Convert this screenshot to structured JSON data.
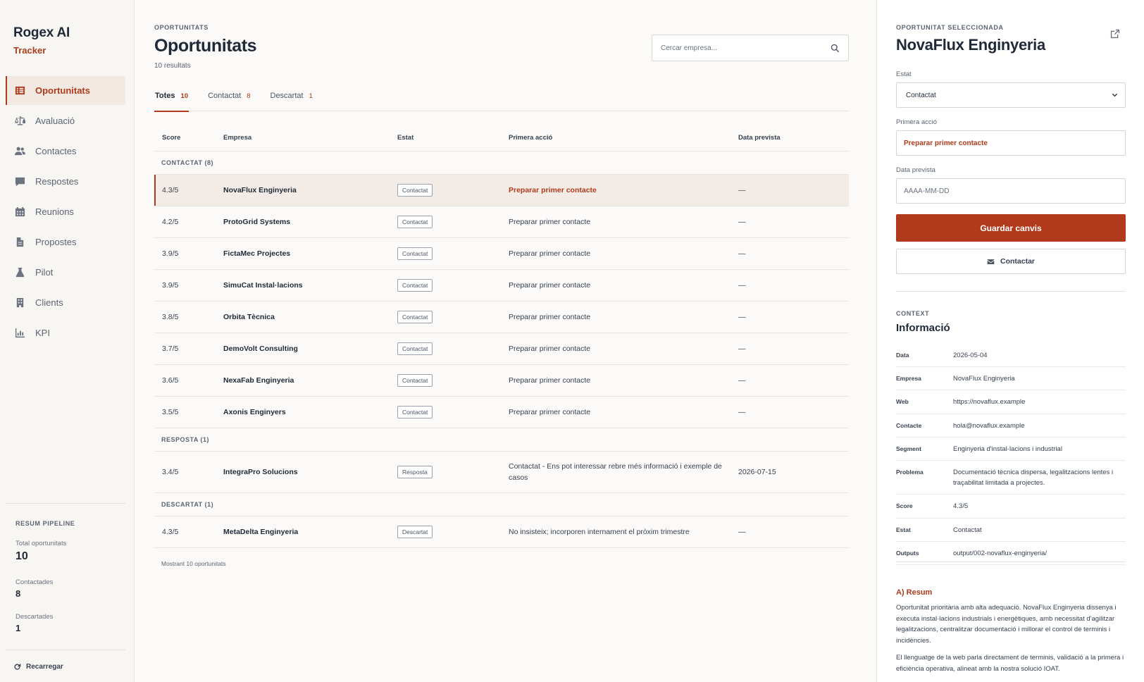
{
  "brand": {
    "title": "Rogex AI",
    "subtitle": "Tracker"
  },
  "sidebar": {
    "items": [
      {
        "label": "Oportunitats",
        "icon": "list-icon"
      },
      {
        "label": "Avaluació",
        "icon": "scale-icon"
      },
      {
        "label": "Contactes",
        "icon": "users-icon"
      },
      {
        "label": "Respostes",
        "icon": "comment-icon"
      },
      {
        "label": "Reunions",
        "icon": "calendar-icon"
      },
      {
        "label": "Propostes",
        "icon": "file-icon"
      },
      {
        "label": "Pilot",
        "icon": "flask-icon"
      },
      {
        "label": "Clients",
        "icon": "building-icon"
      },
      {
        "label": "KPI",
        "icon": "bar-chart-icon"
      }
    ],
    "pipeline": {
      "title": "Resum pipeline",
      "total_label": "Total oportunitats",
      "total_value": "10",
      "contacted_label": "Contactades",
      "contacted_value": "8",
      "discarded_label": "Descartades",
      "discarded_value": "1"
    },
    "reload_label": "Recarregar"
  },
  "main": {
    "eyebrow": "Oportunitats",
    "title": "Oportunitats",
    "count": "10 resultats",
    "search_placeholder": "Cercar empresa...",
    "tabs": [
      {
        "label": "Totes",
        "count": "10"
      },
      {
        "label": "Contactat",
        "count": "8"
      },
      {
        "label": "Descartat",
        "count": "1"
      }
    ],
    "columns": {
      "score": "Score",
      "empresa": "Empresa",
      "estat": "Estat",
      "accio": "Primera acció",
      "data": "Data prevista"
    },
    "groups": [
      {
        "label": "Contactat (8)",
        "rows": [
          {
            "score": "4.3/5",
            "empresa": "NovaFlux Enginyeria",
            "estat": "Contactat",
            "accio": "Preparar primer contacte",
            "data": "—"
          },
          {
            "score": "4.2/5",
            "empresa": "ProtoGrid Systems",
            "estat": "Contactat",
            "accio": "Preparar primer contacte",
            "data": "—"
          },
          {
            "score": "3.9/5",
            "empresa": "FictaMec Projectes",
            "estat": "Contactat",
            "accio": "Preparar primer contacte",
            "data": "—"
          },
          {
            "score": "3.9/5",
            "empresa": "SimuCat Instal·lacions",
            "estat": "Contactat",
            "accio": "Preparar primer contacte",
            "data": "—"
          },
          {
            "score": "3.8/5",
            "empresa": "Orbita Tècnica",
            "estat": "Contactat",
            "accio": "Preparar primer contacte",
            "data": "—"
          },
          {
            "score": "3.7/5",
            "empresa": "DemoVolt Consulting",
            "estat": "Contactat",
            "accio": "Preparar primer contacte",
            "data": "—"
          },
          {
            "score": "3.6/5",
            "empresa": "NexaFab Enginyeria",
            "estat": "Contactat",
            "accio": "Preparar primer contacte",
            "data": "—"
          },
          {
            "score": "3.5/5",
            "empresa": "Axonis Enginyers",
            "estat": "Contactat",
            "accio": "Preparar primer contacte",
            "data": "—"
          }
        ]
      },
      {
        "label": "Resposta (1)",
        "rows": [
          {
            "score": "3.4/5",
            "empresa": "IntegraPro Solucions",
            "estat": "Resposta",
            "accio": "Contactat - Ens pot interessar rebre més informació i exemple de casos",
            "data": "2026-07-15"
          }
        ]
      },
      {
        "label": "Descartat (1)",
        "rows": [
          {
            "score": "4.3/5",
            "empresa": "MetaDelta Enginyeria",
            "estat": "Descartat",
            "accio": "No insisteix; incorporen internament el pròxim trimestre",
            "data": "—"
          }
        ]
      }
    ],
    "footer": "Mostrant 10 oportunitats"
  },
  "detail": {
    "eyebrow": "Oportunitat seleccionada",
    "title": "NovaFlux Enginyeria",
    "estat_label": "Estat",
    "estat_value": "Contactat",
    "accio_label": "Primera acció",
    "accio_value": "Preparar primer contacte",
    "data_label": "Data prevista",
    "data_placeholder": "AAAA-MM-DD",
    "save_label": "Guardar canvis",
    "contact_label": "Contactar",
    "context_eyebrow": "Context",
    "context_title": "Informació",
    "info": [
      {
        "k": "Data",
        "v": "2026-05-04"
      },
      {
        "k": "Empresa",
        "v": "NovaFlux Enginyeria"
      },
      {
        "k": "Web",
        "v": "https://novaflux.example"
      },
      {
        "k": "Contacte",
        "v": "hola@novaflux.example"
      },
      {
        "k": "Segment",
        "v": "Enginyeria d'instal·lacions i industrial"
      },
      {
        "k": "Problema",
        "v": "Documentació tècnica dispersa, legalitzacions lentes i traçabilitat limitada a projectes."
      },
      {
        "k": "Score",
        "v": "4.3/5"
      },
      {
        "k": "Estat",
        "v": "Contactat"
      },
      {
        "k": "Outputs",
        "v": "output/002-novaflux-enginyeria/"
      }
    ],
    "resum_title": "A) Resum",
    "resum_p1": "Oportunitat prioritària amb alta adequació. NovaFlux Enginyeria dissenya i executa instal·lacions industrials i energètiques, amb necessitat d'agilitzar legalitzacions, centralitzar documentació i millorar el control de terminis i incidències.",
    "resum_p2": "El llenguatge de la web parla directament de terminis, validació a la primera i eficiència operativa, alineat amb la nostra solució IOAT."
  },
  "colors": {
    "accent": "#b03a1b",
    "accent_button": "#b23a1c",
    "selected_row": "#f3ece6"
  }
}
